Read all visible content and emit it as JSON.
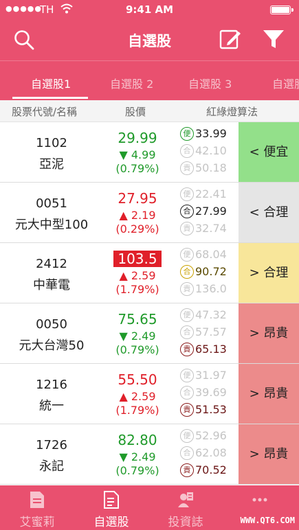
{
  "status_bar": {
    "carrier": "TH",
    "time": "9:41 AM"
  },
  "nav": {
    "title": "自選股"
  },
  "tabs": [
    {
      "label": "自選股1",
      "active": true
    },
    {
      "label": "自選股 2",
      "active": false
    },
    {
      "label": "自選股 3",
      "active": false
    },
    {
      "label": "自選股",
      "active": false
    }
  ],
  "columns": {
    "code_name": "股票代號/名稱",
    "price": "股價",
    "algo": "紅綠燈算法"
  },
  "badges": {
    "cheap": "便",
    "fair": "合",
    "expensive": "貴"
  },
  "stocks": [
    {
      "code": "1102",
      "name": "亞泥",
      "price": "29.99",
      "change": "▼ 4.99",
      "pct": "(0.79%)",
      "cheap": "33.99",
      "fair": "42.10",
      "expensive": "50.18",
      "verdict": "< 便宜"
    },
    {
      "code": "0051",
      "name": "元大中型100",
      "price": "27.95",
      "change": "▲ 2.19",
      "pct": "(0.29%)",
      "cheap": "22.41",
      "fair": "27.99",
      "expensive": "32.74",
      "verdict": "< 合理"
    },
    {
      "code": "2412",
      "name": "中華電",
      "price": "103.5",
      "change": "▲ 2.59",
      "pct": "(1.79%)",
      "cheap": "68.04",
      "fair": "90.72",
      "expensive": "136.0",
      "verdict": "> 合理"
    },
    {
      "code": "0050",
      "name": "元大台灣50",
      "price": "75.65",
      "change": "▼ 2.49",
      "pct": "(0.79%)",
      "cheap": "47.32",
      "fair": "57.57",
      "expensive": "65.13",
      "verdict": "> 昂貴"
    },
    {
      "code": "1216",
      "name": "統一",
      "price": "55.50",
      "change": "▲ 2.59",
      "pct": "(1.79%)",
      "cheap": "31.97",
      "fair": "39.69",
      "expensive": "51.53",
      "verdict": "> 昂貴"
    },
    {
      "code": "1726",
      "name": "永記",
      "price": "82.80",
      "change": "▼ 2.49",
      "pct": "(0.79%)",
      "cheap": "52.96",
      "fair": "62.08",
      "expensive": "70.52",
      "verdict": "> 昂貴"
    }
  ],
  "bottom_tabs": [
    {
      "label": "艾蜜莉",
      "icon": "document-icon",
      "active": false
    },
    {
      "label": "自選股",
      "icon": "stock-list-icon",
      "active": true
    },
    {
      "label": "投資誌",
      "icon": "journal-icon",
      "active": false
    },
    {
      "label": "",
      "icon": "more-icon",
      "active": false
    }
  ],
  "watermark": "WWW.QT6.COM",
  "colors": {
    "brand": "#e9506f",
    "up": "#e0202a",
    "down": "#1f9a2a",
    "cheap_bg": "#93e08a",
    "fair_bg": "#e5e5e5",
    "fair_high_bg": "#f8e69a",
    "expensive_bg": "#ec8b8b"
  }
}
